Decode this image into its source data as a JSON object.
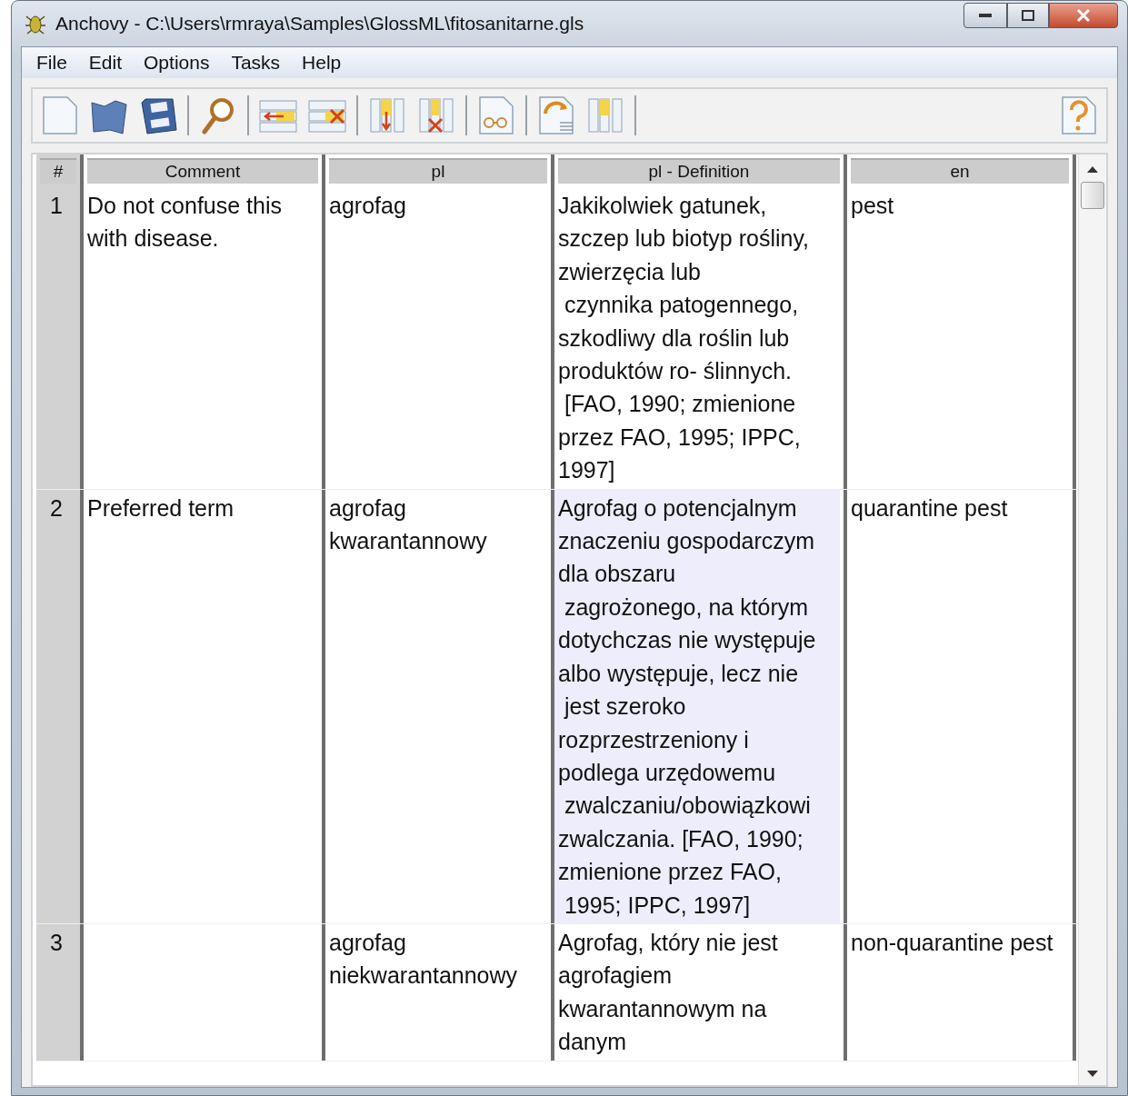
{
  "window": {
    "title": "Anchovy - C:\\Users\\rmraya\\Samples\\GlossML\\fitosanitarne.gls"
  },
  "menu": [
    "File",
    "Edit",
    "Options",
    "Tasks",
    "Help"
  ],
  "table": {
    "columns": [
      "#",
      "Comment",
      "pl",
      "pl - Definition",
      "en"
    ],
    "rows": [
      {
        "cells": [
          {
            "text": "1",
            "selected": false
          },
          {
            "text": "Do not confuse this with disease.",
            "selected": false
          },
          {
            "text": "agrofag",
            "selected": false
          },
          {
            "text": "Jakikolwiek gatunek,\nszczep lub biotyp rośliny,\nzwierzęcia lub\n czynnika patogennego,\nszkodliwy dla roślin lub\nproduktów ro- ślinnych.\n [FAO, 1990; zmienione\nprzez FAO, 1995; IPPC,\n1997]",
            "selected": false
          },
          {
            "text": "pest",
            "selected": false
          }
        ]
      },
      {
        "cells": [
          {
            "text": "2",
            "selected": false
          },
          {
            "text": "Preferred term",
            "selected": false
          },
          {
            "text": "agrofag kwarantannowy",
            "selected": false
          },
          {
            "text": "Agrofag o potencjalnym\nznaczeniu gospodarczym\ndla obszaru\n zagrożonego, na którym\ndotychczas nie występuje\nalbo występuje, lecz nie\n jest szeroko\nrozprzestrzeniony i\npodlega urzędowemu\n zwalczaniu/obowiązkowi\nzwalczania. [FAO, 1990;\nzmienione przez FAO,\n 1995; IPPC, 1997]",
            "selected": true
          },
          {
            "text": "quarantine pest",
            "selected": false
          }
        ]
      },
      {
        "cells": [
          {
            "text": "3",
            "selected": false
          },
          {
            "text": "",
            "selected": false
          },
          {
            "text": "agrofag niekwarantannowy",
            "selected": false
          },
          {
            "text": "Agrofag, który nie jest\nagrofagiem\nkwarantannowym na\ndanym",
            "selected": false
          },
          {
            "text": "non-quarantine pest",
            "selected": false
          }
        ]
      }
    ]
  }
}
